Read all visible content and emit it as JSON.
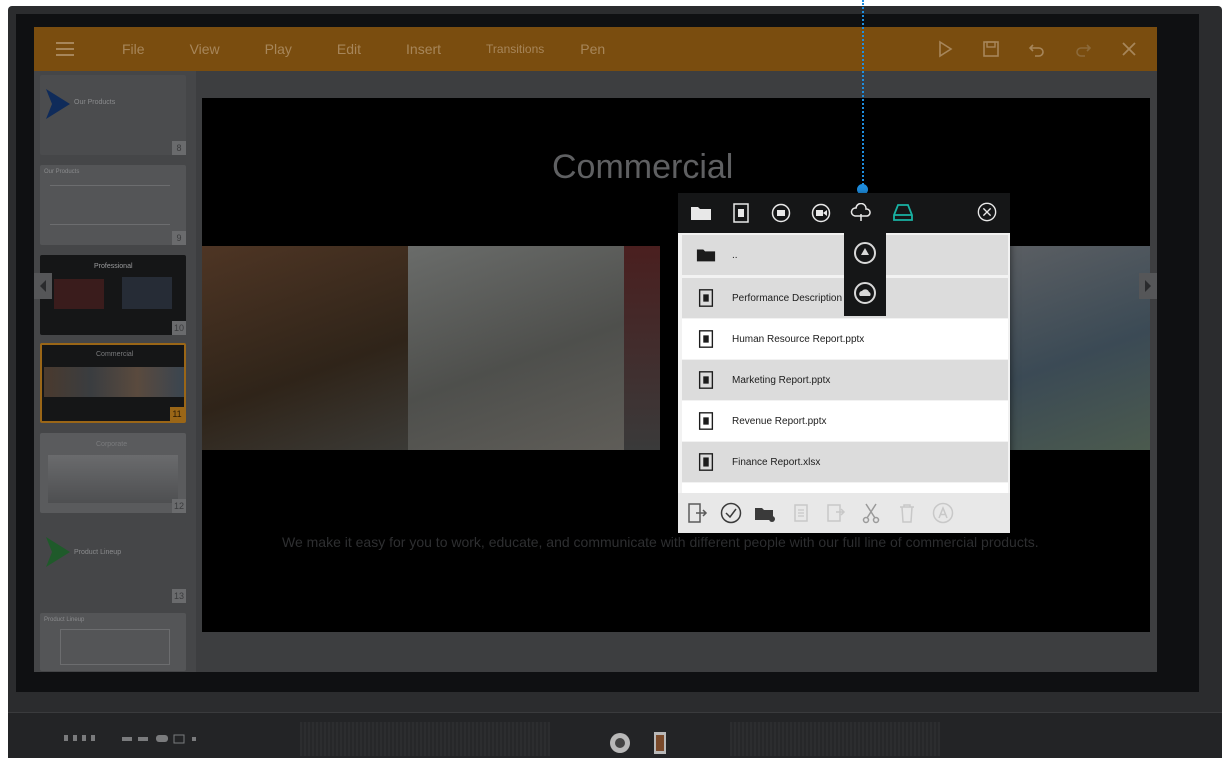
{
  "toolbar": {
    "menu_icon": "hamburger-icon",
    "menus": [
      "File",
      "View",
      "Play",
      "Edit",
      "Insert",
      "Transitions",
      "Pen"
    ],
    "right_icons": [
      "play-icon",
      "save-icon",
      "undo-icon",
      "redo-icon",
      "close-icon"
    ]
  },
  "slides": {
    "items": [
      {
        "num": "8",
        "label": "Our Products"
      },
      {
        "num": "9",
        "label": "Our Products"
      },
      {
        "num": "10",
        "label": "Professional"
      },
      {
        "num": "11",
        "label": "Commercial"
      },
      {
        "num": "12",
        "label": "Corporate"
      },
      {
        "num": "13",
        "label": "Product Lineup"
      },
      {
        "num": "",
        "label": "Product Lineup"
      }
    ],
    "selected": "11"
  },
  "slide": {
    "title": "Commercial",
    "body": "We make it easy for you to work, educate, and communicate with different people with our full line of commercial products."
  },
  "file_dialog": {
    "top_icons": [
      "folder-icon",
      "document-icon",
      "image-icon",
      "video-icon",
      "cloud-icon",
      "drive-icon",
      "close-circle-icon"
    ],
    "cloud_menu": [
      "google-drive-icon",
      "onedrive-icon"
    ],
    "up_row": "..",
    "files": [
      {
        "name": "Performance Description"
      },
      {
        "name": "Human Resource Report.pptx"
      },
      {
        "name": "Marketing Report.pptx"
      },
      {
        "name": "Revenue Report.pptx"
      },
      {
        "name": "Finance Report.xlsx"
      }
    ],
    "bottom_icons": [
      "exit-icon",
      "select-icon",
      "new-folder-icon",
      "copy-icon",
      "paste-icon",
      "cut-icon",
      "delete-icon",
      "rename-icon"
    ]
  },
  "colors": {
    "toolbar": "#7a4d0f",
    "accent_teal": "#19b3a4",
    "pointer_blue": "#1e8ee0",
    "selection": "#9a6617"
  }
}
